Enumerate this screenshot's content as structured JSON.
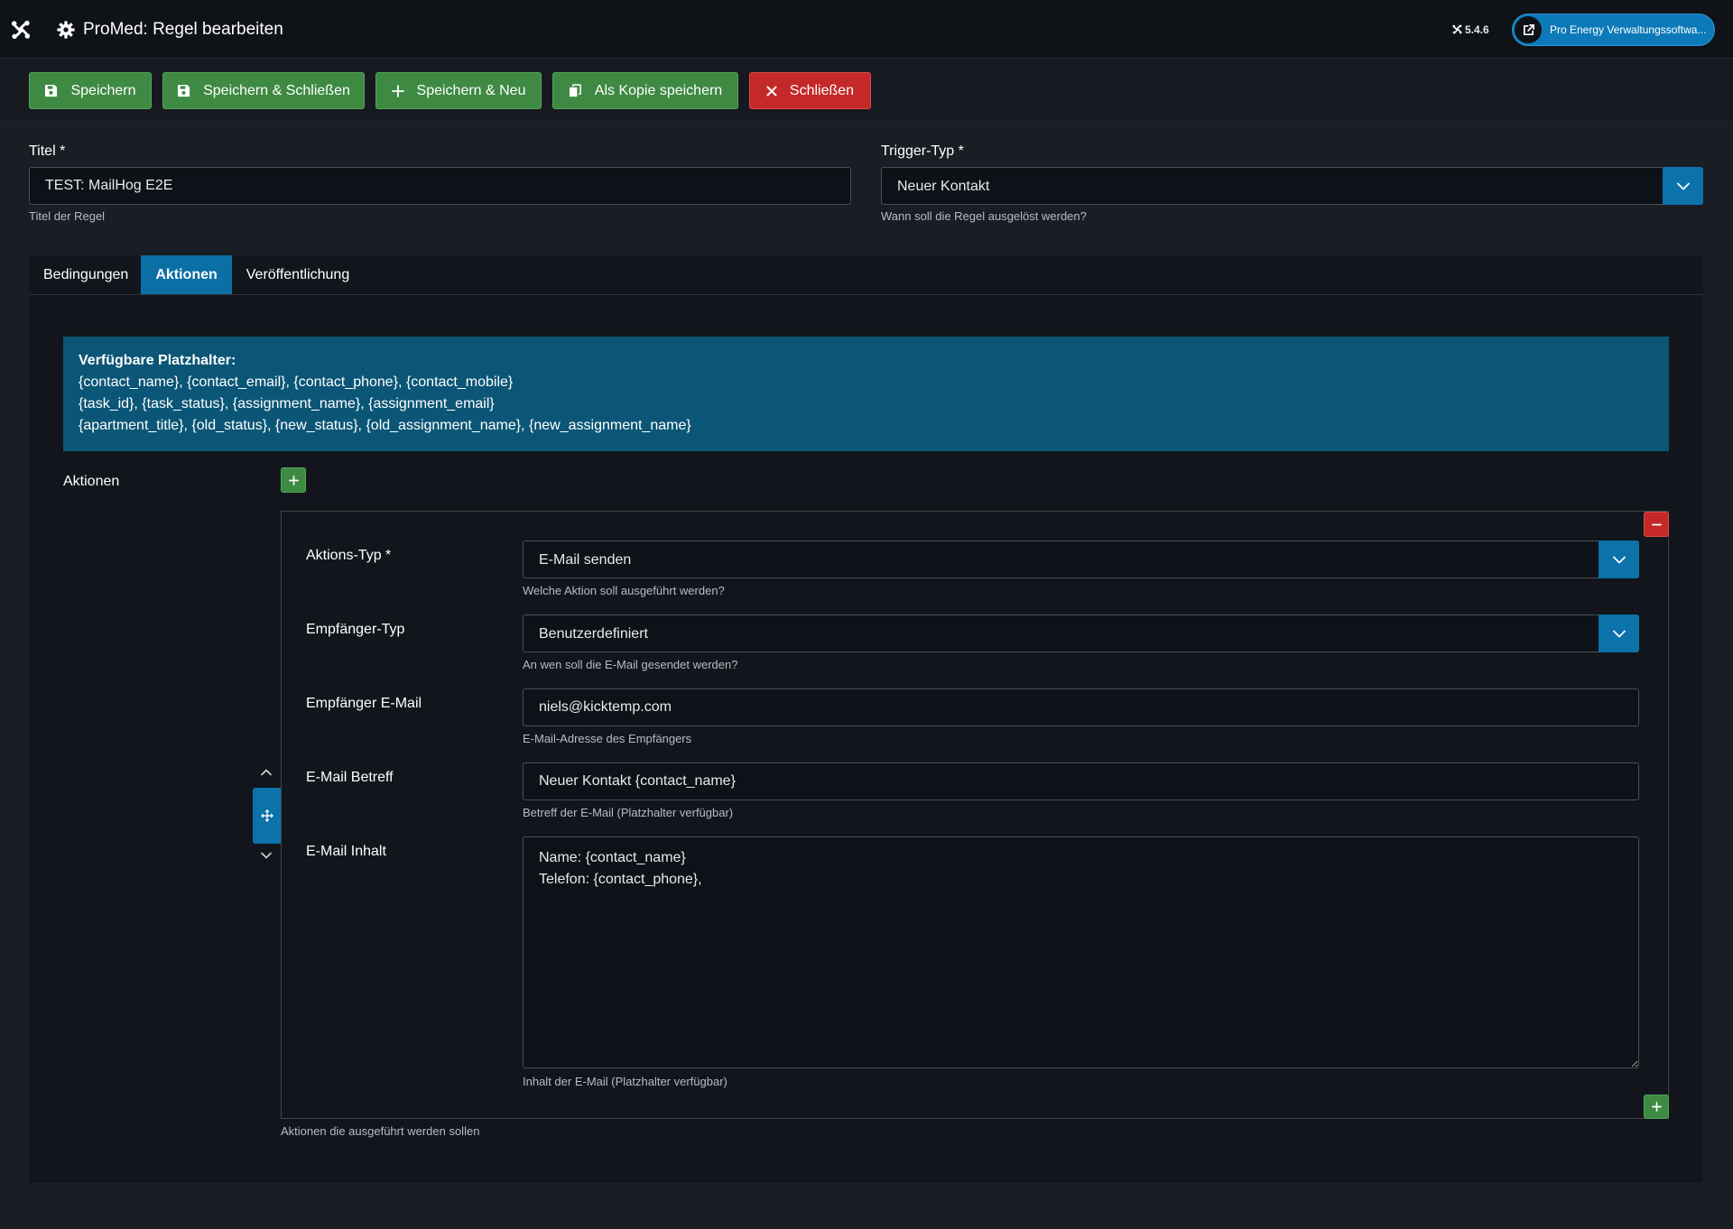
{
  "header": {
    "title": "ProMed: Regel bearbeiten",
    "version": "5.4.6",
    "site_link": "Pro Energy Verwaltungssoftwa..."
  },
  "toolbar": {
    "save": "Speichern",
    "save_close": "Speichern & Schließen",
    "save_new": "Speichern & Neu",
    "save_copy": "Als Kopie speichern",
    "close": "Schließen"
  },
  "form": {
    "title": {
      "label": "Titel *",
      "value": "TEST: MailHog E2E",
      "help": "Titel der Regel"
    },
    "trigger_type": {
      "label": "Trigger-Typ *",
      "value": "Neuer Kontakt",
      "help": "Wann soll die Regel ausgelöst werden?"
    }
  },
  "tabs": [
    {
      "label": "Bedingungen",
      "active": false
    },
    {
      "label": "Aktionen",
      "active": true
    },
    {
      "label": "Veröffentlichung",
      "active": false
    }
  ],
  "placeholders": {
    "heading": "Verfügbare Platzhalter:",
    "lines": [
      "{contact_name}, {contact_email}, {contact_phone}, {contact_mobile}",
      "{task_id}, {task_status}, {assignment_name}, {assignment_email}",
      "{apartment_title}, {old_status}, {new_status}, {old_assignment_name}, {new_assignment_name}"
    ]
  },
  "actions": {
    "label": "Aktionen",
    "help": "Aktionen die ausgeführt werden sollen",
    "row": {
      "action_type": {
        "label": "Aktions-Typ *",
        "value": "E-Mail senden",
        "help": "Welche Aktion soll ausgeführt werden?"
      },
      "recipient_type": {
        "label": "Empfänger-Typ",
        "value": "Benutzerdefiniert",
        "help": "An wen soll die E-Mail gesendet werden?"
      },
      "recipient_email": {
        "label": "Empfänger E-Mail",
        "value": "niels@kicktemp.com",
        "help": "E-Mail-Adresse des Empfängers"
      },
      "email_subject": {
        "label": "E-Mail Betreff",
        "value": "Neuer Kontakt {contact_name}",
        "help": "Betreff der E-Mail (Platzhalter verfügbar)"
      },
      "email_body": {
        "label": "E-Mail Inhalt",
        "value": "Name: {contact_name}\nTelefon: {contact_phone},",
        "help": "Inhalt der E-Mail (Platzhalter verfügbar)"
      }
    }
  },
  "colors": {
    "header_bg": "#0f1217",
    "page_bg": "#191d24",
    "card_bg": "#12161c",
    "primary_blue": "#0b72aa",
    "info_bg": "#0b5676",
    "success_green": "#3e8a43",
    "danger_red": "#c52828"
  },
  "icons": {
    "brand": "joomla-logo-icon",
    "title": "gear-icon",
    "save": "floppy-icon",
    "new": "plus-icon",
    "copy": "copy-icon",
    "close": "close-icon",
    "site": "external-link-icon",
    "dropdown": "chevron-down-icon",
    "reorder": "move-icon"
  }
}
